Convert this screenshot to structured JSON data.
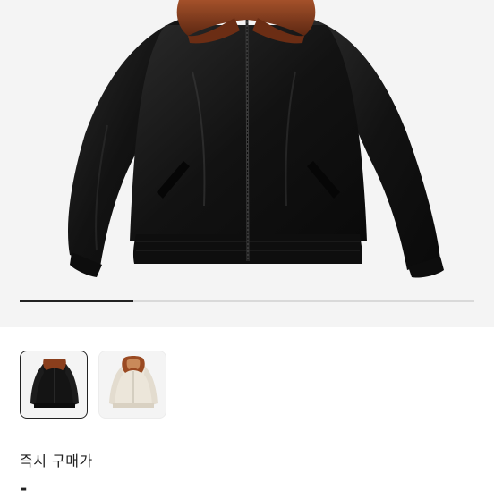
{
  "gallery": {
    "images": [
      {
        "icon": "black-leather-jacket-with-fur-collar",
        "selected": true
      },
      {
        "icon": "cream-leather-jacket-with-fur-hood",
        "selected": false
      }
    ],
    "progress": 0.25
  },
  "purchase": {
    "label": "즉시 구매가",
    "price": "-"
  },
  "colors": {
    "background": "#f4f4f4",
    "jacket": "#141414",
    "fur": "#8a3e1c",
    "cream": "#ece6da"
  }
}
